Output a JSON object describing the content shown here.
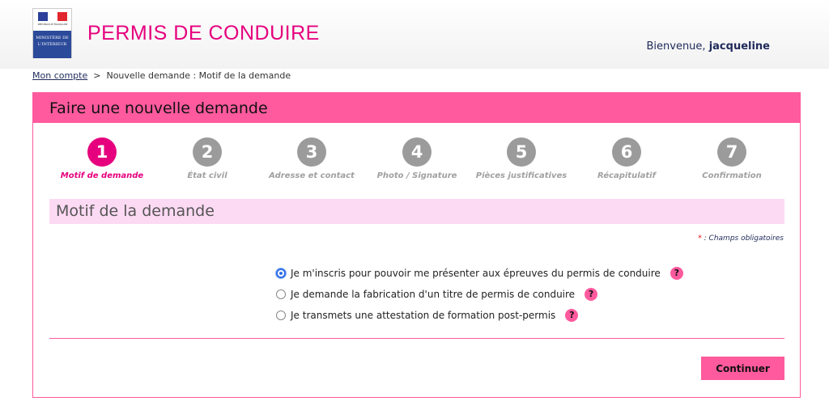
{
  "header": {
    "logo_text": "MINISTÈRE DE L'INTÉRIEUR",
    "logo_subtext": "RÉPUBLIQUE FRANÇAISE",
    "title": "PERMIS DE CONDUIRE",
    "welcome": "Bienvenue,",
    "user": "jacqueline"
  },
  "breadcrumb": {
    "link": "Mon compte",
    "sep": ">",
    "current": "Nouvelle demande : Motif de la demande"
  },
  "panel": {
    "title": "Faire une nouvelle demande"
  },
  "steps": [
    {
      "num": "1",
      "label": "Motif de demande",
      "active": true
    },
    {
      "num": "2",
      "label": "État civil"
    },
    {
      "num": "3",
      "label": "Adresse et contact"
    },
    {
      "num": "4",
      "label": "Photo / Signature"
    },
    {
      "num": "5",
      "label": "Pièces justificatives"
    },
    {
      "num": "6",
      "label": "Récapitulatif"
    },
    {
      "num": "7",
      "label": "Confirmation"
    }
  ],
  "section": {
    "title": "Motif de la demande",
    "required_star": "*",
    "required_text": " : Champs obligatoires"
  },
  "options": [
    {
      "label": "Je m'inscris pour pouvoir me présenter aux épreuves du permis de conduire",
      "selected": true,
      "help": "?"
    },
    {
      "label": "Je demande la fabrication d'un titre de permis de conduire",
      "selected": false,
      "help": "?"
    },
    {
      "label": "Je transmets une attestation de formation post-permis",
      "selected": false,
      "help": "?"
    }
  ],
  "continue_label": "Continuer",
  "colors": {
    "accent": "#ff5a9e",
    "brand": "#e6007e",
    "section_bg": "#fddaf3"
  }
}
